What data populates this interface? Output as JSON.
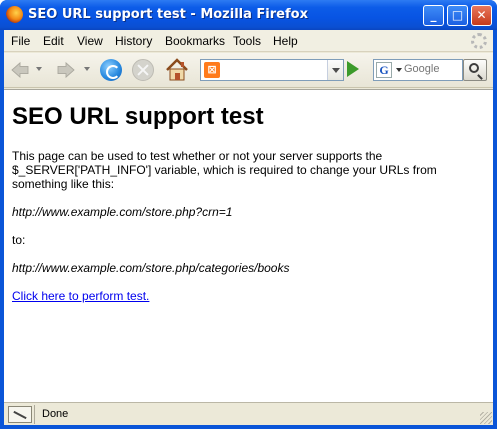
{
  "window": {
    "title": "SEO URL support test - Mozilla Firefox",
    "controls": {
      "minimize": "_",
      "maximize": "□",
      "close": "✕"
    }
  },
  "menubar": {
    "items": [
      {
        "label": "File",
        "accel": "F"
      },
      {
        "label": "Edit",
        "accel": "E"
      },
      {
        "label": "View",
        "accel": "V"
      },
      {
        "label": "History",
        "accel": "s"
      },
      {
        "label": "Bookmarks",
        "accel": "B"
      },
      {
        "label": "Tools",
        "accel": "T"
      },
      {
        "label": "Help",
        "accel": "H"
      }
    ]
  },
  "toolbar": {
    "icons": [
      "back-icon",
      "forward-icon",
      "reload-icon",
      "stop-icon",
      "home-icon"
    ],
    "url_value": "",
    "search_placeholder": "Google",
    "search_engine_letter": "G"
  },
  "page": {
    "heading": "SEO URL support test",
    "intro": "This page can be used to test whether or not your server supports the $_SERVER['PATH_INFO'] variable, which is required to change your URLs from something like this:",
    "example_from": "http://www.example.com/store.php?crn=1",
    "to_label": "to:",
    "example_to": "http://www.example.com/store.php/categories/books",
    "test_link": "Click here to perform test."
  },
  "statusbar": {
    "text": "Done"
  },
  "colors": {
    "titlebar": "#0a55d8",
    "link": "#0000ee",
    "chrome": "#ece9d8"
  }
}
